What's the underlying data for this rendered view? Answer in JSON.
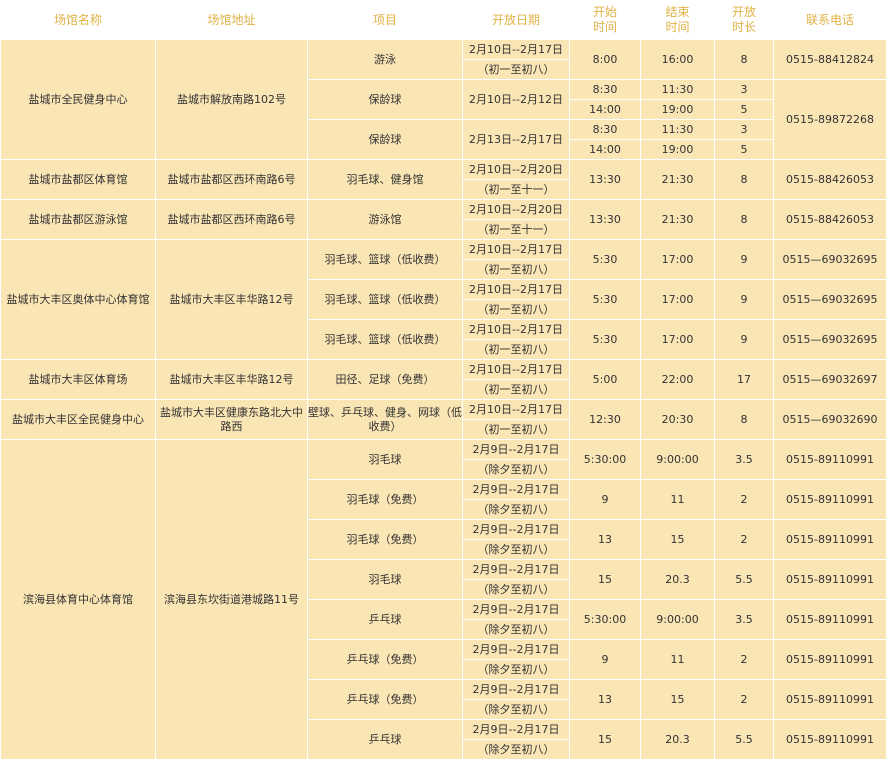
{
  "header": {
    "venue": "场馆名称",
    "address": "场馆地址",
    "item": "项目",
    "dates": "开放日期",
    "start": [
      "开始",
      "时间"
    ],
    "end": [
      "结束",
      "时间"
    ],
    "duration": [
      "开放",
      "时长"
    ],
    "phone": "联系电话"
  },
  "venues": [
    {
      "name": "盐城市全民健身中心",
      "address": "盐城市解放南路102号",
      "groups": [
        {
          "item": "游泳",
          "date1": "2月10日--2月17日",
          "date2": "（初一至初八）",
          "start": [
            "8:00"
          ],
          "end": [
            "16:00"
          ],
          "dur": [
            "8"
          ],
          "phone": "0515-88412824"
        },
        {
          "item": "保龄球",
          "date1": "2月10日--2月12日",
          "date2": "",
          "start": [
            "8:30",
            "14:00"
          ],
          "end": [
            "11:30",
            "19:00"
          ],
          "dur": [
            "3",
            "5"
          ]
        },
        {
          "item": "保龄球",
          "date1": "2月13日--2月17日",
          "date2": "",
          "start": [
            "8:30",
            "14:00"
          ],
          "end": [
            "11:30",
            "19:00"
          ],
          "dur": [
            "3",
            "5"
          ]
        }
      ],
      "shared_phone": "0515-89872268"
    },
    {
      "name": "盐城市盐都区体育馆",
      "address": "盐城市盐都区西环南路6号",
      "groups": [
        {
          "item": "羽毛球、健身馆",
          "date1": "2月10日--2月20日",
          "date2": "（初一至十一）",
          "start": [
            "13:30"
          ],
          "end": [
            "21:30"
          ],
          "dur": [
            "8"
          ],
          "phone": "0515-88426053"
        }
      ]
    },
    {
      "name": "盐城市盐都区游泳馆",
      "address": "盐城市盐都区西环南路6号",
      "groups": [
        {
          "item": "游泳馆",
          "date1": "2月10日--2月20日",
          "date2": "（初一至十一）",
          "start": [
            "13:30"
          ],
          "end": [
            "21:30"
          ],
          "dur": [
            "8"
          ],
          "phone": "0515-88426053"
        }
      ]
    },
    {
      "name": "盐城市大丰区奥体中心体育馆",
      "address": "盐城市大丰区丰华路12号",
      "groups": [
        {
          "item": "羽毛球、篮球（低收费）",
          "date1": "2月10日--2月17日",
          "date2": "（初一至初八）",
          "start": [
            "5:30"
          ],
          "end": [
            "17:00"
          ],
          "dur": [
            "9"
          ],
          "phone": "0515—69032695"
        },
        {
          "item": "羽毛球、篮球（低收费）",
          "date1": "2月10日--2月17日",
          "date2": "（初一至初八）",
          "start": [
            "5:30"
          ],
          "end": [
            "17:00"
          ],
          "dur": [
            "9"
          ],
          "phone": "0515—69032695"
        },
        {
          "item": "羽毛球、篮球（低收费）",
          "date1": "2月10日--2月17日",
          "date2": "（初一至初八）",
          "start": [
            "5:30"
          ],
          "end": [
            "17:00"
          ],
          "dur": [
            "9"
          ],
          "phone": "0515—69032695"
        }
      ]
    },
    {
      "name": "盐城市大丰区体育场",
      "address": "盐城市大丰区丰华路12号",
      "groups": [
        {
          "item": "田径、足球（免费）",
          "date1": "2月10日--2月17日",
          "date2": "（初一至初八）",
          "start": [
            "5:00"
          ],
          "end": [
            "22:00"
          ],
          "dur": [
            "17"
          ],
          "phone": "0515—69032697"
        }
      ]
    },
    {
      "name": "盐城市大丰区全民健身中心",
      "address": "盐城市大丰区健康东路北大中路西",
      "groups": [
        {
          "item": "壁球、乒乓球、健身、网球（低收费）",
          "date1": "2月10日--2月17日",
          "date2": "（初一至初八）",
          "start": [
            "12:30"
          ],
          "end": [
            "20:30"
          ],
          "dur": [
            "8"
          ],
          "phone": "0515—69032690"
        }
      ]
    },
    {
      "name": "滨海县体育中心体育馆",
      "address": "滨海县东坎街道港城路11号",
      "groups": [
        {
          "item": "羽毛球",
          "date1": "2月9日--2月17日",
          "date2": "（除夕至初八）",
          "start": [
            "5:30:00"
          ],
          "end": [
            "9:00:00"
          ],
          "dur": [
            "3.5"
          ],
          "phone": "0515-89110991"
        },
        {
          "item": "羽毛球（免费）",
          "date1": "2月9日--2月17日",
          "date2": "（除夕至初八）",
          "start": [
            "9"
          ],
          "end": [
            "11"
          ],
          "dur": [
            "2"
          ],
          "phone": "0515-89110991"
        },
        {
          "item": "羽毛球（免费）",
          "date1": "2月9日--2月17日",
          "date2": "（除夕至初八）",
          "start": [
            "13"
          ],
          "end": [
            "15"
          ],
          "dur": [
            "2"
          ],
          "phone": "0515-89110991"
        },
        {
          "item": "羽毛球",
          "date1": "2月9日--2月17日",
          "date2": "（除夕至初八）",
          "start": [
            "15"
          ],
          "end": [
            "20.3"
          ],
          "dur": [
            "5.5"
          ],
          "phone": "0515-89110991"
        },
        {
          "item": "乒乓球",
          "date1": "2月9日--2月17日",
          "date2": "（除夕至初八）",
          "start": [
            "5:30:00"
          ],
          "end": [
            "9:00:00"
          ],
          "dur": [
            "3.5"
          ],
          "phone": "0515-89110991"
        },
        {
          "item": "乒乓球（免费）",
          "date1": "2月9日--2月17日",
          "date2": "（除夕至初八）",
          "start": [
            "9"
          ],
          "end": [
            "11"
          ],
          "dur": [
            "2"
          ],
          "phone": "0515-89110991"
        },
        {
          "item": "乒乓球（免费）",
          "date1": "2月9日--2月17日",
          "date2": "（除夕至初八）",
          "start": [
            "13"
          ],
          "end": [
            "15"
          ],
          "dur": [
            "2"
          ],
          "phone": "0515-89110991"
        },
        {
          "item": "乒乓球",
          "date1": "2月9日--2月17日",
          "date2": "（除夕至初八）",
          "start": [
            "15"
          ],
          "end": [
            "20.3"
          ],
          "dur": [
            "5.5"
          ],
          "phone": "0515-89110991"
        }
      ]
    }
  ]
}
